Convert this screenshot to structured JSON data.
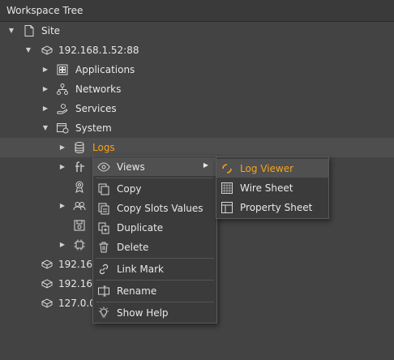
{
  "panel": {
    "title": "Workspace Tree"
  },
  "tree": {
    "site": "Site",
    "host": "192.168.1.52:88",
    "applications": "Applications",
    "networks": "Networks",
    "services": "Services",
    "system": "System",
    "logs": "Logs",
    "host2": "192.168",
    "host3": "192.168",
    "host4": "127.0.0"
  },
  "context_menu": {
    "views": "Views",
    "copy": "Copy",
    "copy_slots": "Copy Slots Values",
    "duplicate": "Duplicate",
    "delete": "Delete",
    "link_mark": "Link Mark",
    "rename": "Rename",
    "show_help": "Show Help"
  },
  "views_submenu": {
    "log_viewer": "Log Viewer",
    "wire_sheet": "Wire Sheet",
    "property_sheet": "Property Sheet"
  },
  "colors": {
    "accent": "#f7a21b",
    "background": "#434343",
    "menu_bg": "#3b3b3b"
  }
}
